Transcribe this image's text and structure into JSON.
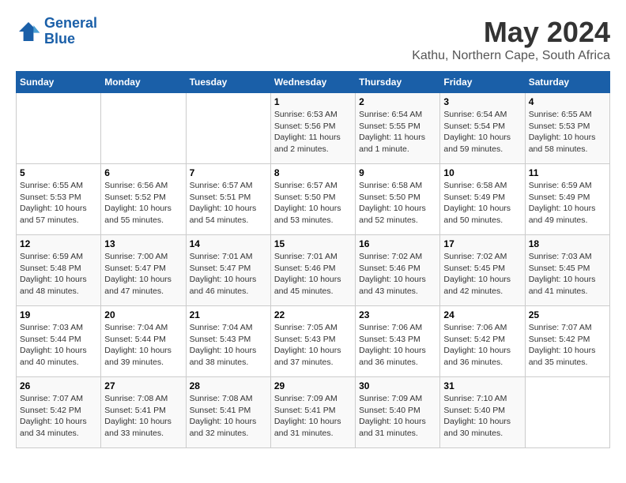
{
  "logo": {
    "line1": "General",
    "line2": "Blue"
  },
  "title": "May 2024",
  "subtitle": "Kathu, Northern Cape, South Africa",
  "headers": [
    "Sunday",
    "Monday",
    "Tuesday",
    "Wednesday",
    "Thursday",
    "Friday",
    "Saturday"
  ],
  "weeks": [
    [
      {
        "day": "",
        "info": ""
      },
      {
        "day": "",
        "info": ""
      },
      {
        "day": "",
        "info": ""
      },
      {
        "day": "1",
        "info": "Sunrise: 6:53 AM\nSunset: 5:56 PM\nDaylight: 11 hours\nand 2 minutes."
      },
      {
        "day": "2",
        "info": "Sunrise: 6:54 AM\nSunset: 5:55 PM\nDaylight: 11 hours\nand 1 minute."
      },
      {
        "day": "3",
        "info": "Sunrise: 6:54 AM\nSunset: 5:54 PM\nDaylight: 10 hours\nand 59 minutes."
      },
      {
        "day": "4",
        "info": "Sunrise: 6:55 AM\nSunset: 5:53 PM\nDaylight: 10 hours\nand 58 minutes."
      }
    ],
    [
      {
        "day": "5",
        "info": "Sunrise: 6:55 AM\nSunset: 5:53 PM\nDaylight: 10 hours\nand 57 minutes."
      },
      {
        "day": "6",
        "info": "Sunrise: 6:56 AM\nSunset: 5:52 PM\nDaylight: 10 hours\nand 55 minutes."
      },
      {
        "day": "7",
        "info": "Sunrise: 6:57 AM\nSunset: 5:51 PM\nDaylight: 10 hours\nand 54 minutes."
      },
      {
        "day": "8",
        "info": "Sunrise: 6:57 AM\nSunset: 5:50 PM\nDaylight: 10 hours\nand 53 minutes."
      },
      {
        "day": "9",
        "info": "Sunrise: 6:58 AM\nSunset: 5:50 PM\nDaylight: 10 hours\nand 52 minutes."
      },
      {
        "day": "10",
        "info": "Sunrise: 6:58 AM\nSunset: 5:49 PM\nDaylight: 10 hours\nand 50 minutes."
      },
      {
        "day": "11",
        "info": "Sunrise: 6:59 AM\nSunset: 5:49 PM\nDaylight: 10 hours\nand 49 minutes."
      }
    ],
    [
      {
        "day": "12",
        "info": "Sunrise: 6:59 AM\nSunset: 5:48 PM\nDaylight: 10 hours\nand 48 minutes."
      },
      {
        "day": "13",
        "info": "Sunrise: 7:00 AM\nSunset: 5:47 PM\nDaylight: 10 hours\nand 47 minutes."
      },
      {
        "day": "14",
        "info": "Sunrise: 7:01 AM\nSunset: 5:47 PM\nDaylight: 10 hours\nand 46 minutes."
      },
      {
        "day": "15",
        "info": "Sunrise: 7:01 AM\nSunset: 5:46 PM\nDaylight: 10 hours\nand 45 minutes."
      },
      {
        "day": "16",
        "info": "Sunrise: 7:02 AM\nSunset: 5:46 PM\nDaylight: 10 hours\nand 43 minutes."
      },
      {
        "day": "17",
        "info": "Sunrise: 7:02 AM\nSunset: 5:45 PM\nDaylight: 10 hours\nand 42 minutes."
      },
      {
        "day": "18",
        "info": "Sunrise: 7:03 AM\nSunset: 5:45 PM\nDaylight: 10 hours\nand 41 minutes."
      }
    ],
    [
      {
        "day": "19",
        "info": "Sunrise: 7:03 AM\nSunset: 5:44 PM\nDaylight: 10 hours\nand 40 minutes."
      },
      {
        "day": "20",
        "info": "Sunrise: 7:04 AM\nSunset: 5:44 PM\nDaylight: 10 hours\nand 39 minutes."
      },
      {
        "day": "21",
        "info": "Sunrise: 7:04 AM\nSunset: 5:43 PM\nDaylight: 10 hours\nand 38 minutes."
      },
      {
        "day": "22",
        "info": "Sunrise: 7:05 AM\nSunset: 5:43 PM\nDaylight: 10 hours\nand 37 minutes."
      },
      {
        "day": "23",
        "info": "Sunrise: 7:06 AM\nSunset: 5:43 PM\nDaylight: 10 hours\nand 36 minutes."
      },
      {
        "day": "24",
        "info": "Sunrise: 7:06 AM\nSunset: 5:42 PM\nDaylight: 10 hours\nand 36 minutes."
      },
      {
        "day": "25",
        "info": "Sunrise: 7:07 AM\nSunset: 5:42 PM\nDaylight: 10 hours\nand 35 minutes."
      }
    ],
    [
      {
        "day": "26",
        "info": "Sunrise: 7:07 AM\nSunset: 5:42 PM\nDaylight: 10 hours\nand 34 minutes."
      },
      {
        "day": "27",
        "info": "Sunrise: 7:08 AM\nSunset: 5:41 PM\nDaylight: 10 hours\nand 33 minutes."
      },
      {
        "day": "28",
        "info": "Sunrise: 7:08 AM\nSunset: 5:41 PM\nDaylight: 10 hours\nand 32 minutes."
      },
      {
        "day": "29",
        "info": "Sunrise: 7:09 AM\nSunset: 5:41 PM\nDaylight: 10 hours\nand 31 minutes."
      },
      {
        "day": "30",
        "info": "Sunrise: 7:09 AM\nSunset: 5:40 PM\nDaylight: 10 hours\nand 31 minutes."
      },
      {
        "day": "31",
        "info": "Sunrise: 7:10 AM\nSunset: 5:40 PM\nDaylight: 10 hours\nand 30 minutes."
      },
      {
        "day": "",
        "info": ""
      }
    ]
  ]
}
